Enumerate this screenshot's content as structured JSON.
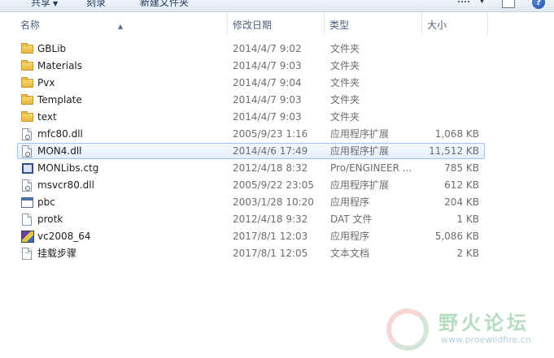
{
  "toolbar": {
    "share_label": "共享",
    "burn_label": "刻录",
    "new_folder_label": "新建文件夹"
  },
  "columns": {
    "name": "名称",
    "date": "修改日期",
    "type": "类型",
    "size": "大小"
  },
  "files": [
    {
      "name": "GBLib",
      "date": "2014/4/7 9:02",
      "type": "文件夹",
      "size": "",
      "icon": "folder-icon"
    },
    {
      "name": "Materials",
      "date": "2014/4/7 9:03",
      "type": "文件夹",
      "size": "",
      "icon": "folder-icon"
    },
    {
      "name": "Pvx",
      "date": "2014/4/7 9:04",
      "type": "文件夹",
      "size": "",
      "icon": "folder-icon"
    },
    {
      "name": "Template",
      "date": "2014/4/7 9:03",
      "type": "文件夹",
      "size": "",
      "icon": "folder-icon"
    },
    {
      "name": "text",
      "date": "2014/4/7 9:03",
      "type": "文件夹",
      "size": "",
      "icon": "folder-icon"
    },
    {
      "name": "mfc80.dll",
      "date": "2005/9/23 1:16",
      "type": "应用程序扩展",
      "size": "1,068 KB",
      "icon": "dll-icon"
    },
    {
      "name": "MON4.dll",
      "date": "2014/4/6 17:49",
      "type": "应用程序扩展",
      "size": "11,512 KB",
      "icon": "dll-icon"
    },
    {
      "name": "MONLibs.ctg",
      "date": "2012/4/18 8:32",
      "type": "Pro/ENGINEER ...",
      "size": "785 KB",
      "icon": "ctg-file-icon"
    },
    {
      "name": "msvcr80.dll",
      "date": "2005/9/22 23:05",
      "type": "应用程序扩展",
      "size": "612 KB",
      "icon": "dll-icon"
    },
    {
      "name": "pbc",
      "date": "2003/1/28 10:20",
      "type": "应用程序",
      "size": "204 KB",
      "icon": "application-icon"
    },
    {
      "name": "protk",
      "date": "2012/4/18 9:32",
      "type": "DAT 文件",
      "size": "1 KB",
      "icon": "blank-file-icon"
    },
    {
      "name": "vc2008_64",
      "date": "2017/8/1 12:03",
      "type": "应用程序",
      "size": "5,086 KB",
      "icon": "installer-icon"
    },
    {
      "name": "挂载步骤",
      "date": "2017/8/1 12:05",
      "type": "文本文档",
      "size": "2 KB",
      "icon": "text-file-icon"
    }
  ],
  "selected_index": 6,
  "watermark": {
    "title": "野火论坛",
    "url": "www.proewildfire.cn"
  },
  "colors": {
    "selection_border": "#99c6f2",
    "selection_fill": "#e4effc",
    "header_text": "#4c607a"
  }
}
